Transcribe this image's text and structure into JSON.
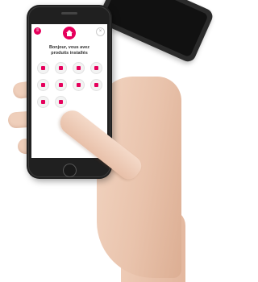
{
  "app": {
    "menu_icon": "menu-icon",
    "home_icon": "home-icon",
    "close_icon": "close-icon",
    "greeting_line1": "Bonjour, vous avez",
    "greeting_line2_count": "",
    "greeting_line2_text": "produits installés",
    "accent_color": "#e6005c",
    "tiles": [
      {
        "icon": "device-icon",
        "label": ""
      },
      {
        "icon": "device-icon",
        "label": ""
      },
      {
        "icon": "thermostat-icon",
        "label": ""
      },
      {
        "icon": "thermostat-icon",
        "label": ""
      },
      {
        "icon": "device-icon",
        "label": ""
      },
      {
        "icon": "device-icon",
        "label": ""
      },
      {
        "icon": "device-icon",
        "label": ""
      },
      {
        "icon": "device-icon",
        "label": ""
      },
      {
        "icon": "location-icon",
        "label": ""
      },
      {
        "icon": "device-icon",
        "label": ""
      }
    ]
  }
}
